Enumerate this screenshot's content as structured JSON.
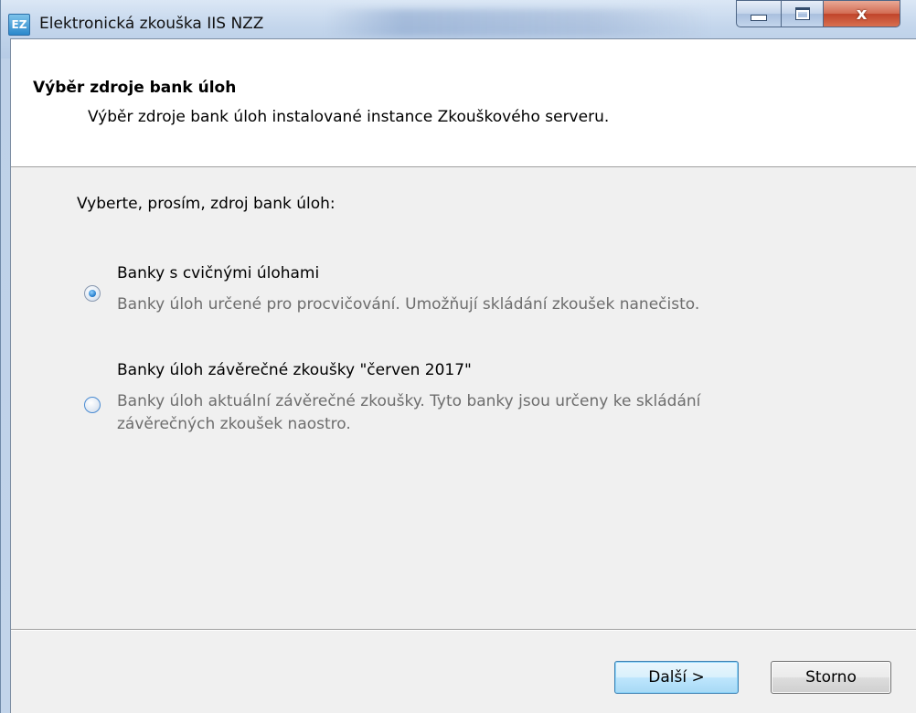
{
  "window": {
    "icon_text": "EZ",
    "title": "Elektronická zkouška IIS NZZ",
    "close_glyph": "x"
  },
  "header": {
    "title": "Výběr zdroje bank úloh",
    "subtitle": "Výběr zdroje bank úloh instalované instance Zkouškového serveru."
  },
  "content": {
    "prompt": "Vyberte, prosím, zdroj bank úloh:",
    "options": [
      {
        "label": "Banky s cvičnými úlohami",
        "description": [
          "Banky úloh určené pro procvičování. Umožňují skládání zkoušek nanečisto."
        ],
        "selected": true
      },
      {
        "label": "Banky úloh závěrečné zkoušky \"červen 2017\"",
        "description": [
          "Banky úloh aktuální závěrečné zkoušky. Tyto banky jsou určeny ke skládání",
          "závěrečných zkoušek naostro."
        ],
        "selected": false
      }
    ]
  },
  "footer": {
    "next_label": "Další >",
    "cancel_label": "Storno"
  }
}
